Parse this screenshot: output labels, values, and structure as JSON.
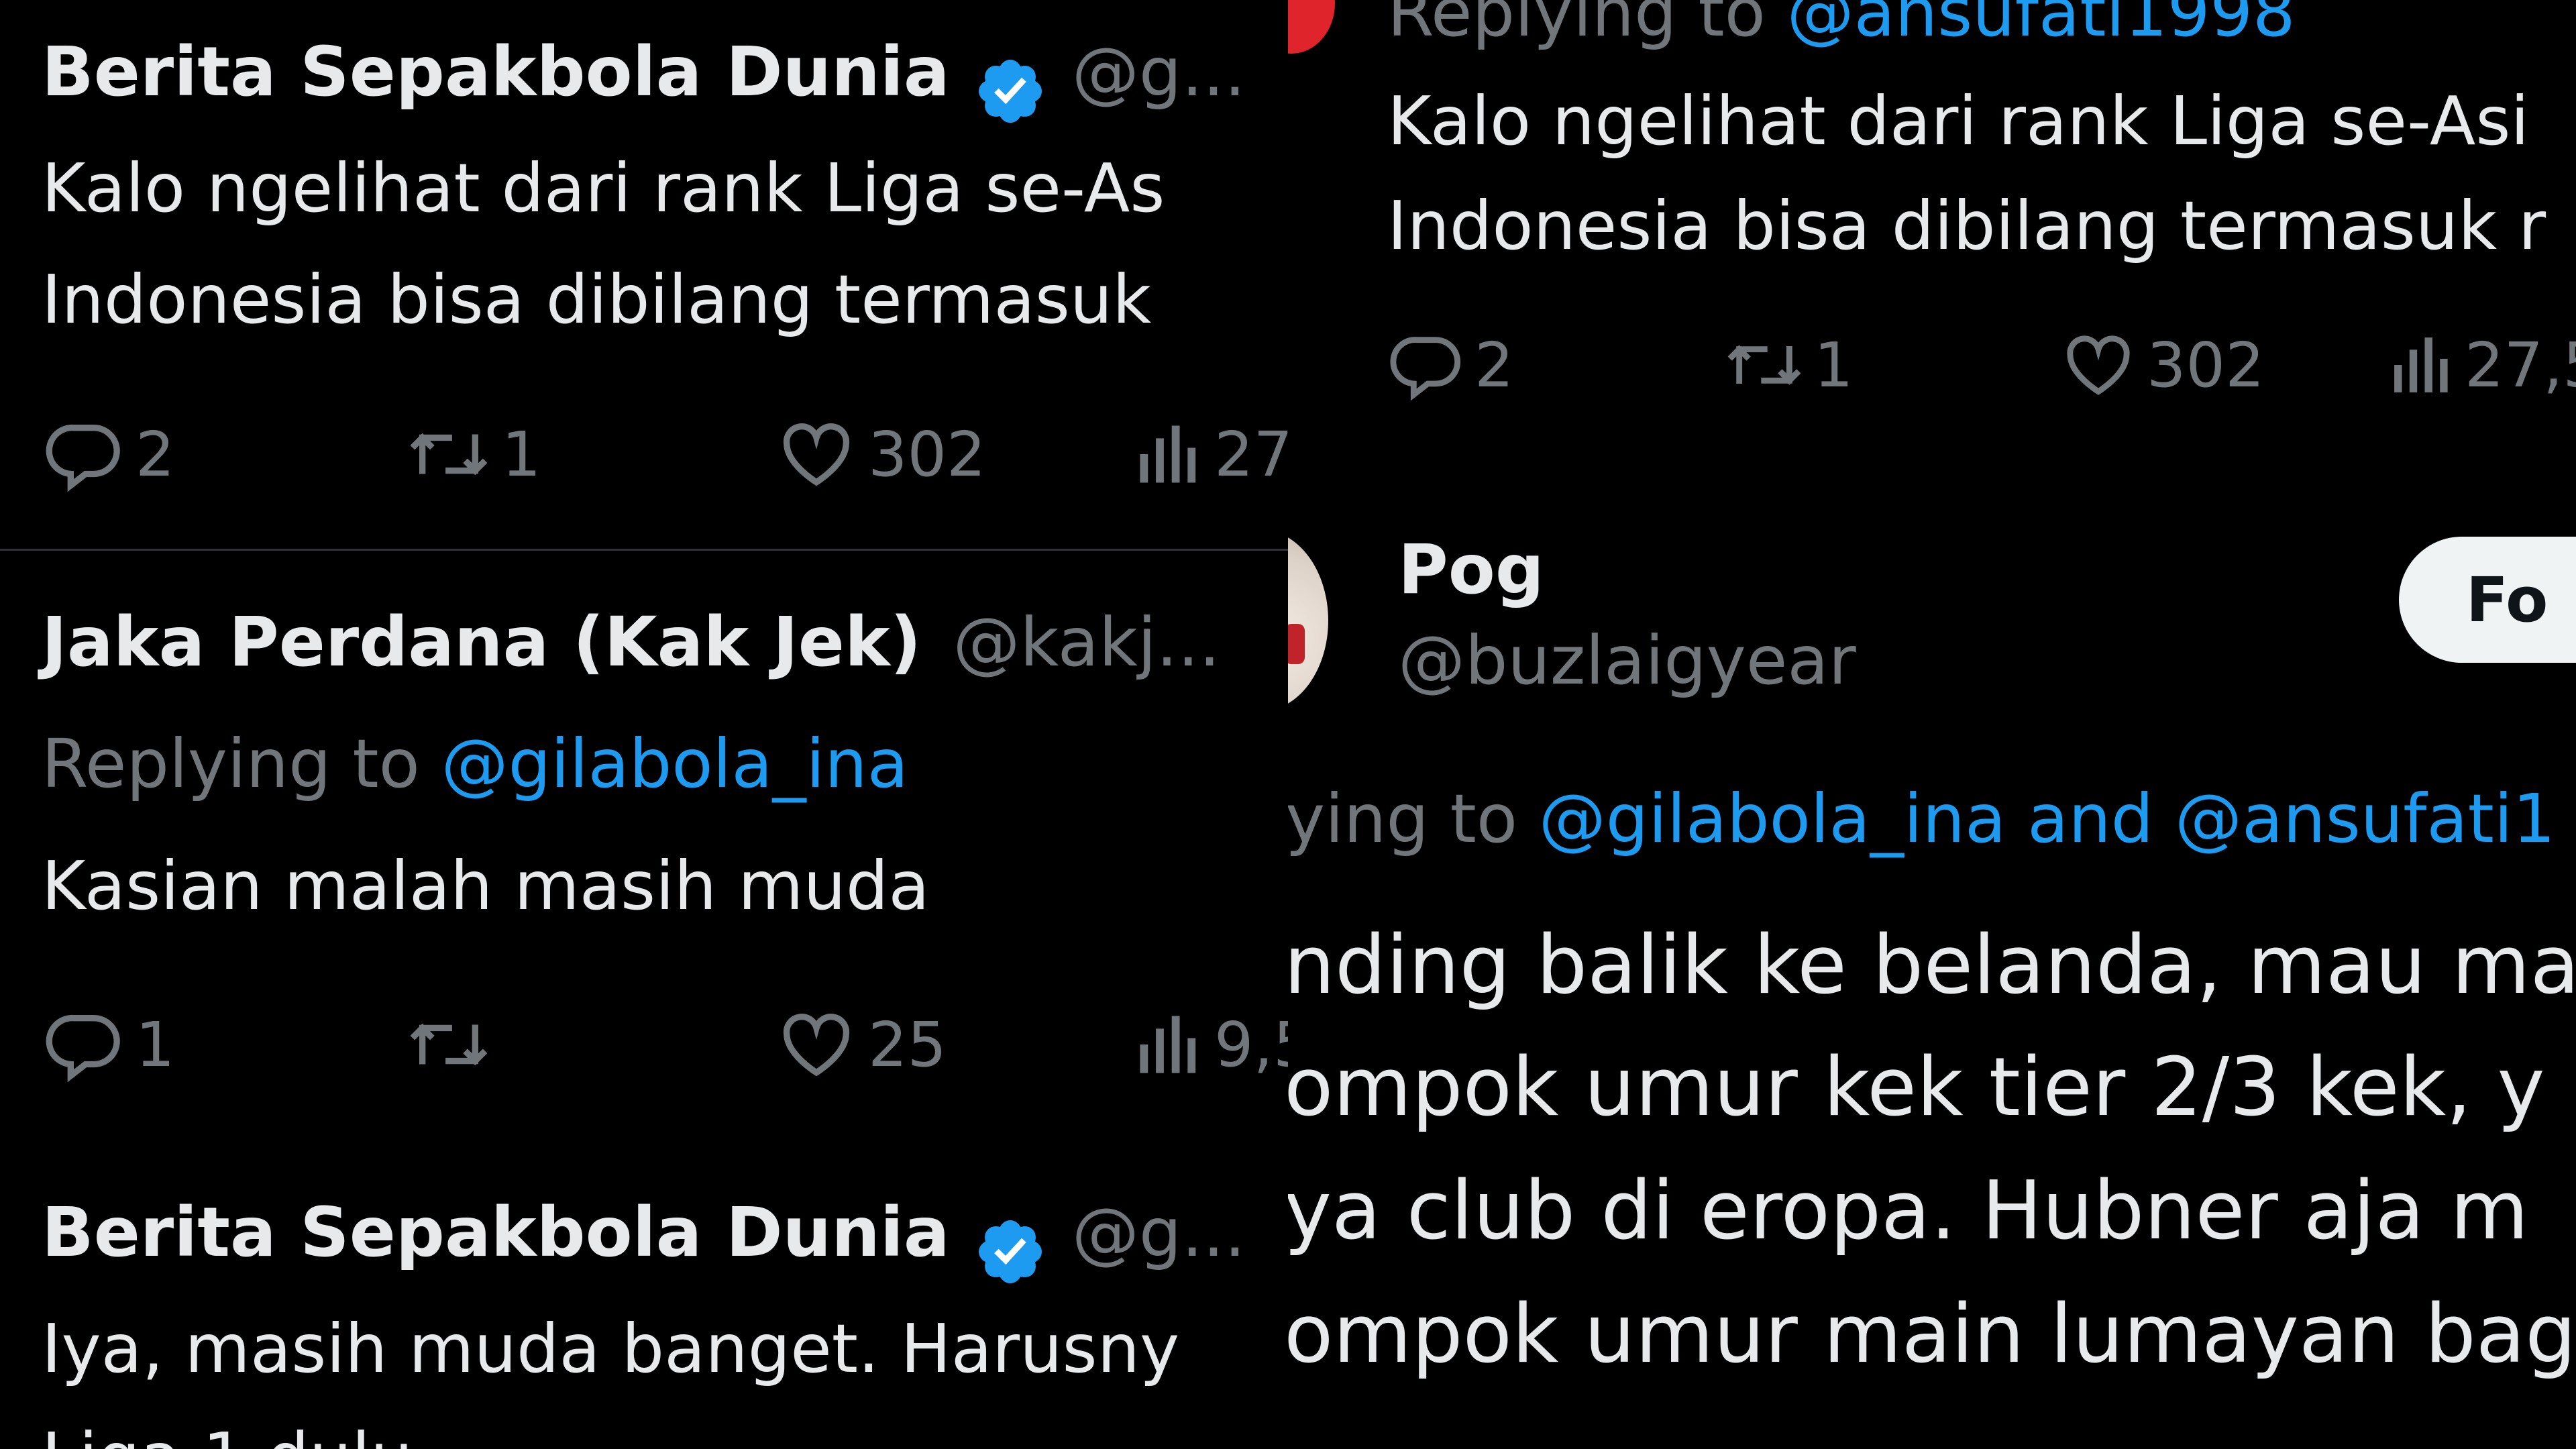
{
  "left": {
    "post1": {
      "name": "Berita Sepakbola Dunia",
      "handle": "@g...",
      "text_line1": "Kalo ngelihat dari rank Liga se-As",
      "text_line2": "Indonesia bisa dibilang termasuk",
      "replies": "2",
      "reposts": "1",
      "likes": "302",
      "views": "27"
    },
    "post2": {
      "name": "Jaka Perdana (Kak Jek)",
      "handle": "@kakj...",
      "replying_label": "Replying to",
      "replying_mention": "@gilabola_ina",
      "text": "Kasian malah masih muda",
      "replies": "1",
      "reposts": "",
      "likes": "25",
      "views": "9,5"
    },
    "post3": {
      "name": "Berita Sepakbola Dunia",
      "handle": "@g...",
      "text_line1": "Iya, masih muda banget. Harusny",
      "text_line2": "Liga 1 dulu"
    }
  },
  "right": {
    "post1": {
      "replying_label": "Replying to",
      "replying_mention": "@ansufati1998",
      "text_line1": "Kalo ngelihat dari rank Liga se-Asi",
      "text_line2": "Indonesia bisa dibilang termasuk r",
      "replies": "2",
      "reposts": "1",
      "likes": "302",
      "views": "27,5"
    },
    "post2": {
      "name": "Pog",
      "handle": "@buzlaigyear",
      "follow_label": "Fo",
      "replying_label": "ying to",
      "replying_mentions": "@gilabola_ina and @ansufati1",
      "text_line1": "nding balik ke belanda, mau ma",
      "text_line2": "ompok umur kek tier 2/3 kek, y",
      "text_line3": "ya club di eropa. Hubner aja m",
      "text_line4": "ompok umur main lumayan bag"
    }
  },
  "colors": {
    "background": "#000000",
    "text": "#e7e9ea",
    "muted": "#71767b",
    "mention": "#1d9bf0",
    "verified": "#1d9bf0",
    "divider": "#2f3336"
  },
  "icons": [
    "reply-icon",
    "repost-icon",
    "like-icon",
    "views-icon",
    "verified-badge-icon",
    "avatar"
  ]
}
